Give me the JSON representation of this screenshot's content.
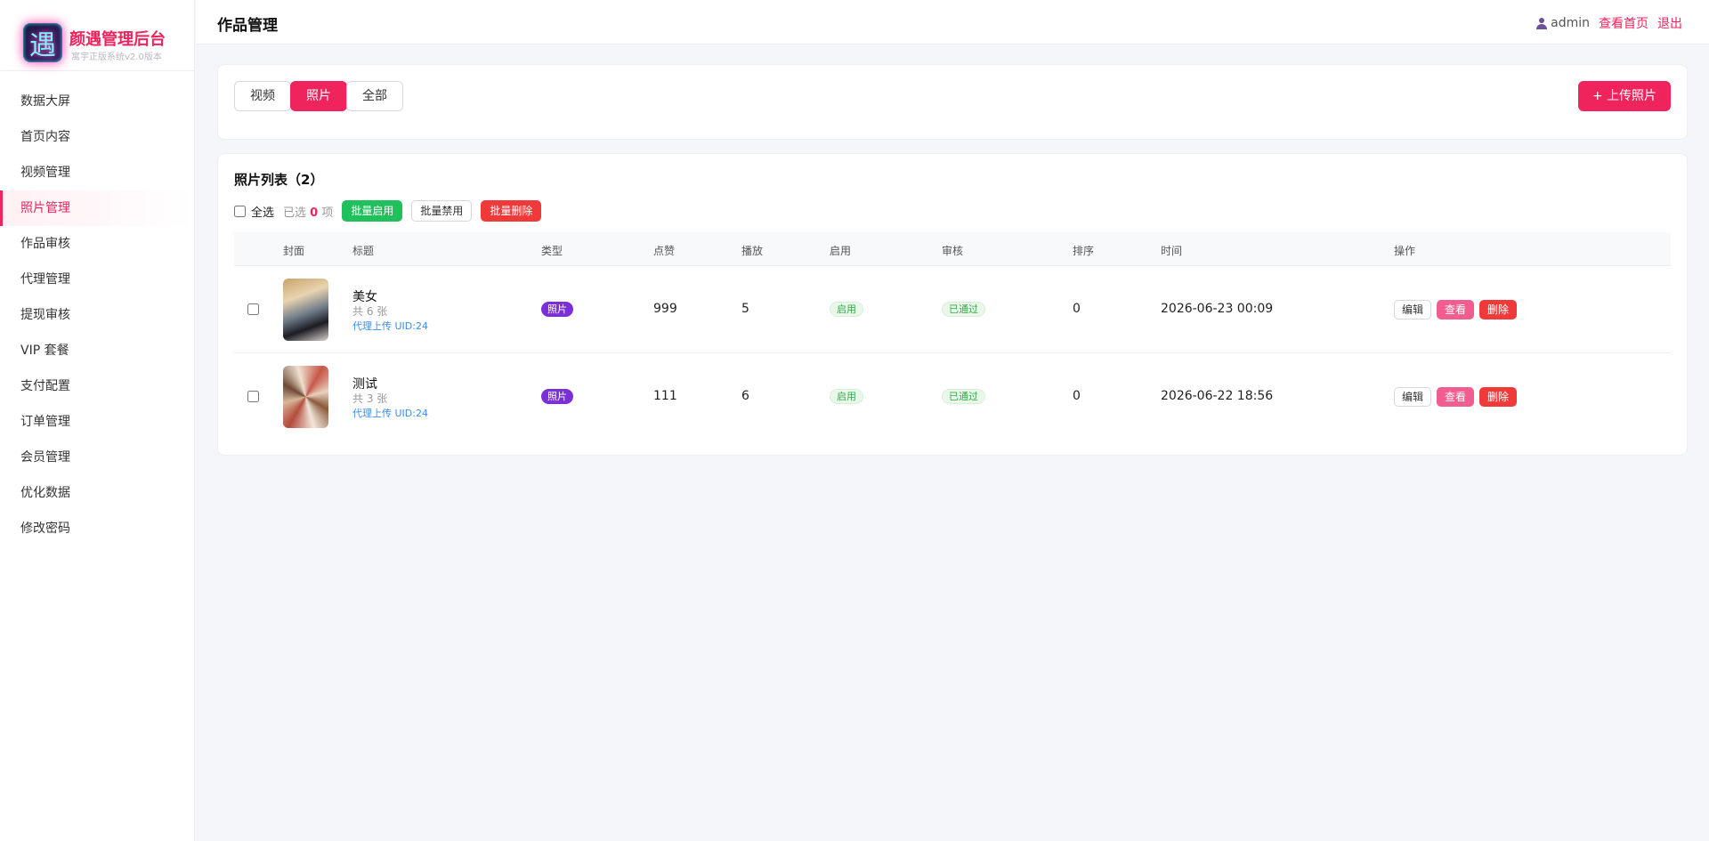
{
  "brand": {
    "logo_char": "遇",
    "title": "颜遇管理后台",
    "subtitle": "寓宇正版系统v2.0版本"
  },
  "sidebar": {
    "items": [
      {
        "label": "数据大屏"
      },
      {
        "label": "首页内容"
      },
      {
        "label": "视频管理"
      },
      {
        "label": "照片管理",
        "active": true
      },
      {
        "label": "作品审核"
      },
      {
        "label": "代理管理"
      },
      {
        "label": "提现审核"
      },
      {
        "label": "VIP 套餐"
      },
      {
        "label": "支付配置"
      },
      {
        "label": "订单管理"
      },
      {
        "label": "会员管理"
      },
      {
        "label": "优化数据"
      },
      {
        "label": "修改密码"
      }
    ]
  },
  "header": {
    "title": "作品管理",
    "username": "admin",
    "view_home": "查看首页",
    "logout": "退出"
  },
  "filters": {
    "video": "视频",
    "photo": "照片",
    "all": "全部",
    "active": "photo",
    "upload": "+  上传照片"
  },
  "list": {
    "title": "照片列表（2）",
    "select_all": "全选",
    "selected_prefix": "已选",
    "selected_count": "0",
    "selected_suffix": "项",
    "batch_enable": "批量启用",
    "batch_disable": "批量禁用",
    "batch_delete": "批量删除",
    "columns": {
      "cover": "封面",
      "title": "标题",
      "type": "类型",
      "likes": "点赞",
      "plays": "播放",
      "enabled": "启用",
      "review": "审核",
      "sort": "排序",
      "time": "时间",
      "actions": "操作"
    },
    "rows": [
      {
        "title": "美女",
        "count": "共 6 张",
        "agent": "代理上传 UID:24",
        "type": "照片",
        "likes": "999",
        "plays": "5",
        "enabled": "启用",
        "review": "已通过",
        "sort": "0",
        "time": "2026-06-23 00:09",
        "edit": "编辑",
        "view": "查看",
        "delete": "删除"
      },
      {
        "title": "测试",
        "count": "共 3 张",
        "agent": "代理上传 UID:24",
        "type": "照片",
        "likes": "111",
        "plays": "6",
        "enabled": "启用",
        "review": "已通过",
        "sort": "0",
        "time": "2026-06-22 18:56",
        "edit": "编辑",
        "view": "查看",
        "delete": "删除"
      }
    ]
  },
  "colors": {
    "accent": "#f0245c",
    "type_badge": "#7b2fd6",
    "success": "#20c05c",
    "danger": "#f03a3a",
    "link": "#3b8df0"
  }
}
